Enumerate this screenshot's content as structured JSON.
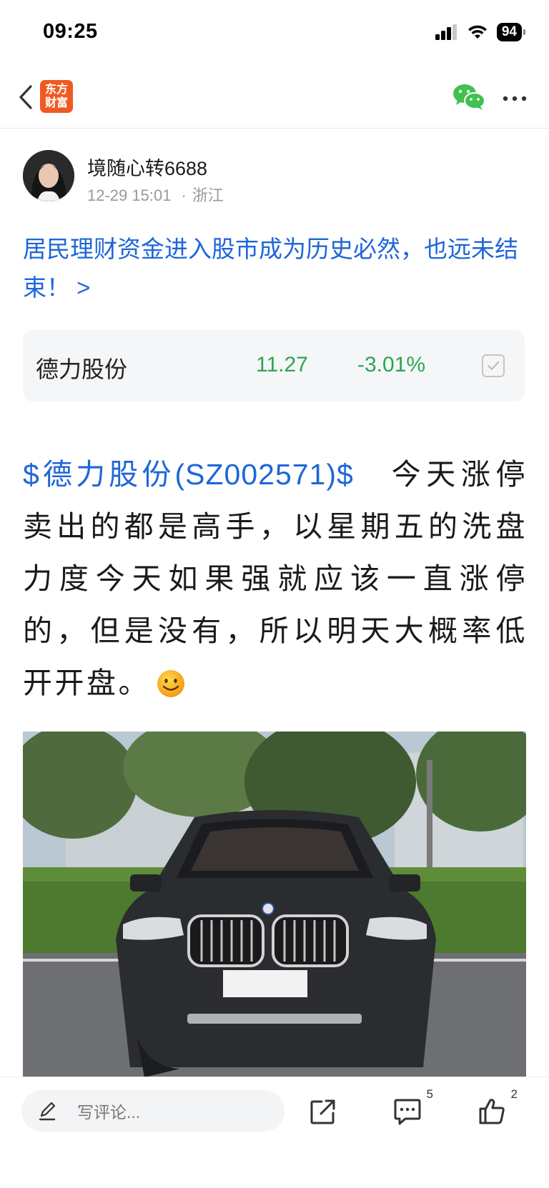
{
  "status": {
    "time": "09:25",
    "battery": "94"
  },
  "nav": {
    "logo_text": "东方财富",
    "logo_line1": "东方",
    "logo_line2": "财富"
  },
  "author": {
    "name": "境随心转6688",
    "date": "12-29 15:01",
    "location": "浙江"
  },
  "post": {
    "title": "居民理财资金进入股市成为历史必然，也远未结束！ >",
    "stock_link": "$德力股份(SZ002571)$",
    "body_text": "今天涨停卖出的都是高手，以星期五的洗盘力度今天如果强就应该一直涨停的，但是没有，所以明天大概率低开开盘。"
  },
  "stock_card": {
    "name": "德力股份",
    "price": "11.27",
    "change": "-3.01%",
    "color": "#2aa653"
  },
  "bottom_bar": {
    "comment_placeholder": "写评论...",
    "comment_count": "5",
    "like_count": "2"
  },
  "colors": {
    "link": "#1e66d9",
    "brand": "#f05a22",
    "wechat": "#3fc24f"
  }
}
